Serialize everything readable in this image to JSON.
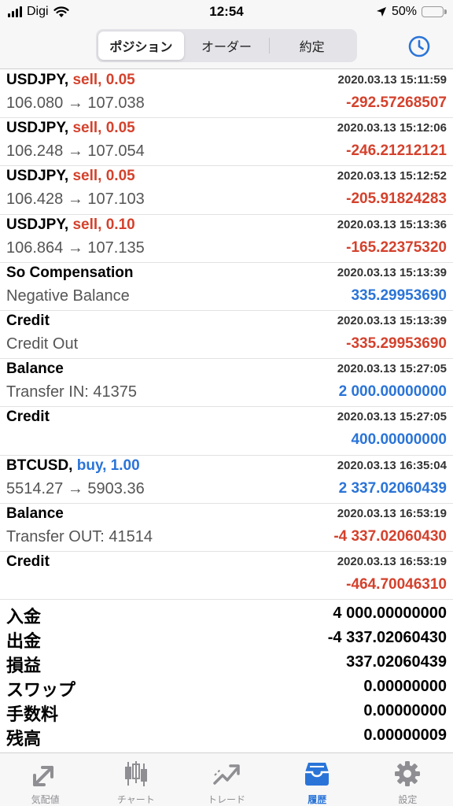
{
  "status_bar": {
    "carrier": "Digi",
    "time": "12:54",
    "battery": "50%",
    "battery_level": 0.5
  },
  "segments": [
    {
      "label": "ポジション",
      "active": true
    },
    {
      "label": "オーダー",
      "active": false
    },
    {
      "label": "約定",
      "active": false
    }
  ],
  "rows": [
    {
      "symbol": "USDJPY,",
      "side": "sell, 0.05",
      "time": "2020.03.13 15:11:59",
      "detail": "106.080 → 107.038",
      "amount": "-292.57268507"
    },
    {
      "symbol": "USDJPY,",
      "side": "sell, 0.05",
      "time": "2020.03.13 15:12:06",
      "detail": "106.248 → 107.054",
      "amount": "-246.21212121"
    },
    {
      "symbol": "USDJPY,",
      "side": "sell, 0.05",
      "time": "2020.03.13 15:12:52",
      "detail": "106.428 → 107.103",
      "amount": "-205.91824283"
    },
    {
      "symbol": "USDJPY,",
      "side": "sell, 0.10",
      "time": "2020.03.13 15:13:36",
      "detail": "106.864 → 107.135",
      "amount": "-165.22375320"
    },
    {
      "symbol": "So Compensation",
      "side": "",
      "time": "2020.03.13 15:13:39",
      "detail": "Negative Balance",
      "amount": "335.29953690"
    },
    {
      "symbol": "Credit",
      "side": "",
      "time": "2020.03.13 15:13:39",
      "detail": "Credit Out",
      "amount": "-335.29953690"
    },
    {
      "symbol": "Balance",
      "side": "",
      "time": "2020.03.13 15:27:05",
      "detail": "Transfer IN: 41375",
      "amount": "2 000.00000000"
    },
    {
      "symbol": "Credit",
      "side": "",
      "time": "2020.03.13 15:27:05",
      "detail": "",
      "amount": "400.00000000"
    },
    {
      "symbol": "BTCUSD,",
      "side": "buy, 1.00",
      "time": "2020.03.13 16:35:04",
      "detail": "5514.27 → 5903.36",
      "amount": "2 337.02060439"
    },
    {
      "symbol": "Balance",
      "side": "",
      "time": "2020.03.13 16:53:19",
      "detail": "Transfer OUT: 41514",
      "amount": "-4 337.02060430"
    },
    {
      "symbol": "Credit",
      "side": "",
      "time": "2020.03.13 16:53:19",
      "detail": "",
      "amount": "-464.70046310"
    }
  ],
  "summary": [
    {
      "label": "入金",
      "value": "4 000.00000000"
    },
    {
      "label": "出金",
      "value": "-4 337.02060430"
    },
    {
      "label": "損益",
      "value": "337.02060439"
    },
    {
      "label": "スワップ",
      "value": "0.00000000"
    },
    {
      "label": "手数料",
      "value": "0.00000000"
    },
    {
      "label": "残高",
      "value": "0.00000009"
    }
  ],
  "tabs": [
    {
      "label": "気配値",
      "icon": "quotes-icon",
      "active": false
    },
    {
      "label": "チャート",
      "icon": "chart-icon",
      "active": false
    },
    {
      "label": "トレード",
      "icon": "trade-icon",
      "active": false
    },
    {
      "label": "履歴",
      "icon": "history-icon",
      "active": true
    },
    {
      "label": "設定",
      "icon": "settings-icon",
      "active": false
    }
  ],
  "colors": {
    "negative": "#d4412c",
    "positive": "#2a74d8",
    "accent": "#2a74d8",
    "inactive_tab": "#8e8e93"
  }
}
